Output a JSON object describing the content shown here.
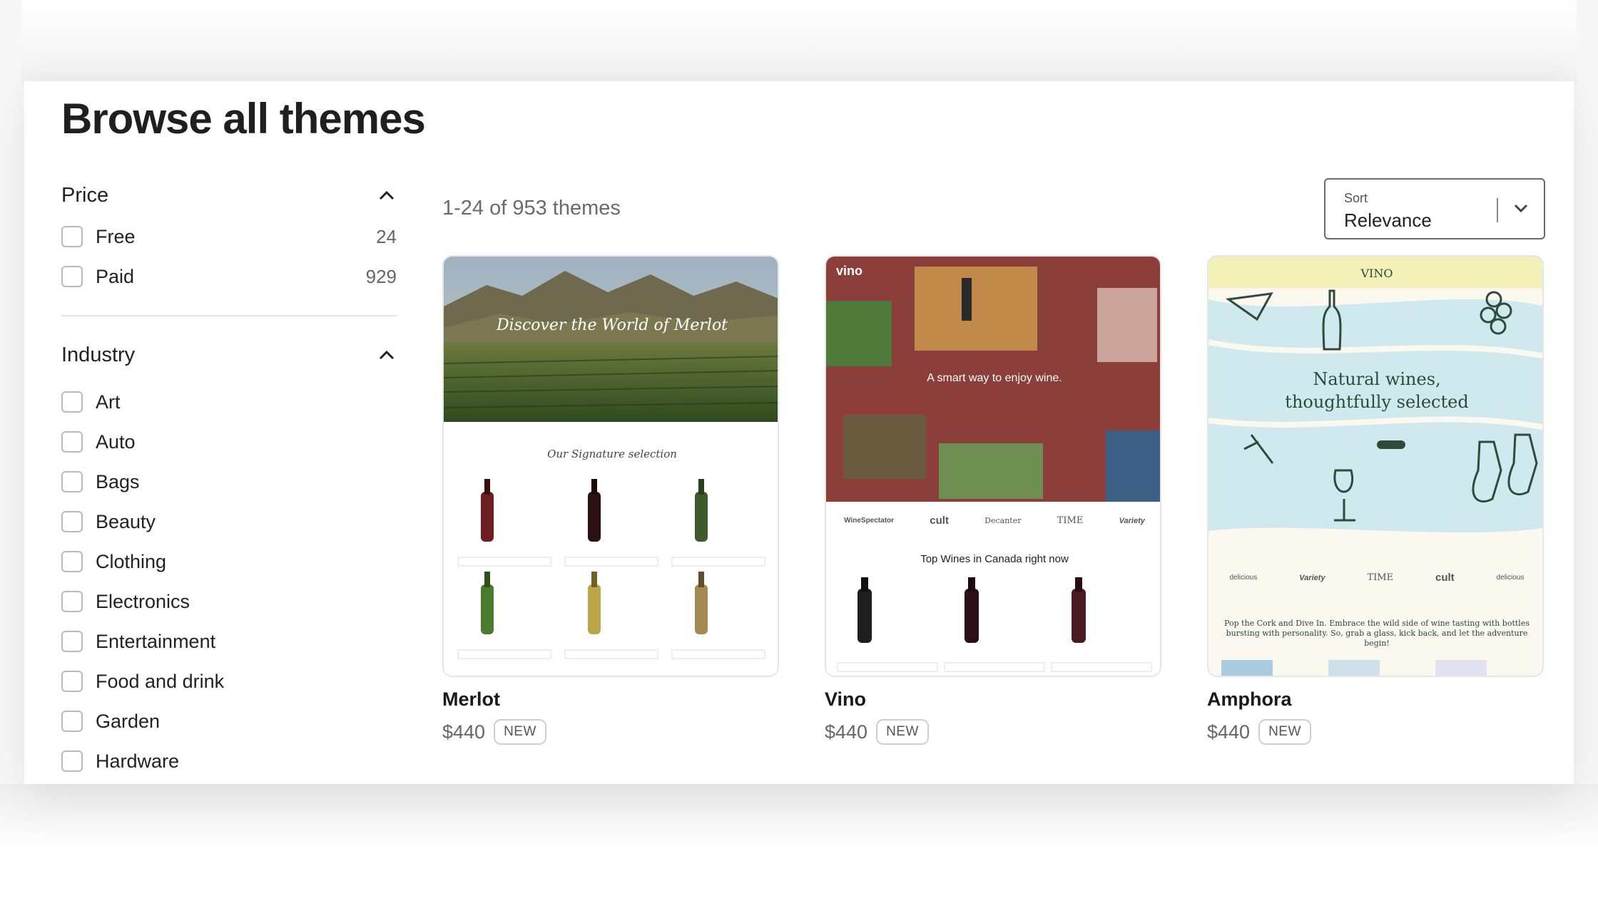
{
  "page": {
    "title": "Browse all themes"
  },
  "filters": {
    "price": {
      "title": "Price",
      "options": [
        {
          "label": "Free",
          "count": "24"
        },
        {
          "label": "Paid",
          "count": "929"
        }
      ]
    },
    "industry": {
      "title": "Industry",
      "options": [
        {
          "label": "Art"
        },
        {
          "label": "Auto"
        },
        {
          "label": "Bags"
        },
        {
          "label": "Beauty"
        },
        {
          "label": "Clothing"
        },
        {
          "label": "Electronics"
        },
        {
          "label": "Entertainment"
        },
        {
          "label": "Food and drink"
        },
        {
          "label": "Garden"
        },
        {
          "label": "Hardware"
        }
      ]
    }
  },
  "results": {
    "count_text": "1-24 of 953 themes"
  },
  "sort": {
    "label": "Sort",
    "value": "Relevance"
  },
  "themes": [
    {
      "name": "Merlot",
      "price": "$440",
      "badge": "NEW",
      "preview": {
        "hero_script": "Discover the World of Merlot",
        "section_title": "Our Signature selection"
      }
    },
    {
      "name": "Vino",
      "price": "$440",
      "badge": "NEW",
      "preview": {
        "logo": "vino",
        "tagline": "A smart way to enjoy wine.",
        "brands": [
          "WineSpectator",
          "cult",
          "Decanter",
          "TIME",
          "Variety"
        ],
        "section_title": "Top Wines in Canada right now"
      }
    },
    {
      "name": "Amphora",
      "price": "$440",
      "badge": "NEW",
      "preview": {
        "logo": "VINO",
        "headline_1": "Natural wines,",
        "headline_2": "thoughtfully selected",
        "brands": [
          "delicious",
          "Variety",
          "TIME",
          "cult",
          "delicious"
        ],
        "body": "Pop the Cork and Dive In. Embrace the wild side of wine tasting with bottles bursting with personality. So, grab a glass, kick back, and let the adventure begin!"
      }
    }
  ],
  "colors": {
    "vino_bg": "#8c3f3a",
    "amphora_sky": "#cfe9ee",
    "amphora_top": "#f3f0b8"
  }
}
